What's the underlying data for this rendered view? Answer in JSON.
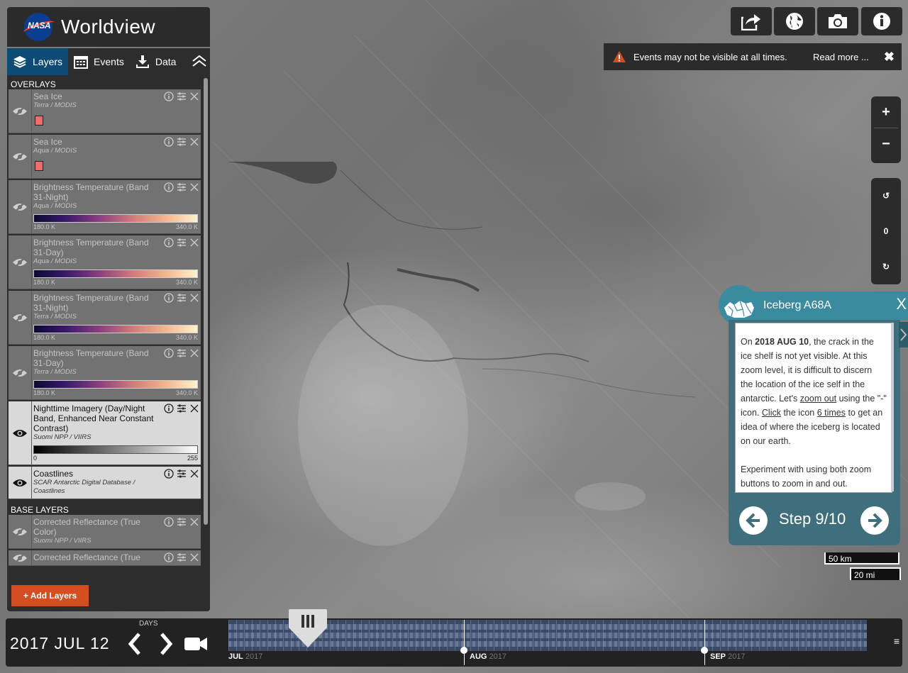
{
  "app": {
    "title": "Worldview",
    "agency": "NASA"
  },
  "tabs": [
    {
      "label": "Layers",
      "icon": "layers-icon"
    },
    {
      "label": "Events",
      "icon": "calendar-icon"
    },
    {
      "label": "Data",
      "icon": "download-icon"
    }
  ],
  "overlays_header": "OVERLAYS",
  "base_header": "BASE LAYERS",
  "overlays": [
    {
      "name": "Sea Ice",
      "source": "Terra / MODIS",
      "visible": false,
      "legend": "swatch"
    },
    {
      "name": "Sea Ice",
      "source": "Aqua / MODIS",
      "visible": false,
      "legend": "swatch"
    },
    {
      "name": "Brightness Temperature (Band 31-Night)",
      "source": "Aqua / MODIS",
      "visible": false,
      "legend": "thermal",
      "min": "180.0 K",
      "max": "340.0 K"
    },
    {
      "name": "Brightness Temperature (Band 31-Day)",
      "source": "Aqua / MODIS",
      "visible": false,
      "legend": "thermal",
      "min": "180.0 K",
      "max": "340.0 K"
    },
    {
      "name": "Brightness Temperature (Band 31-Night)",
      "source": "Terra / MODIS",
      "visible": false,
      "legend": "thermal",
      "min": "180.0 K",
      "max": "340.0 K"
    },
    {
      "name": "Brightness Temperature (Band 31-Day)",
      "source": "Terra / MODIS",
      "visible": false,
      "legend": "thermal",
      "min": "180.0 K",
      "max": "340.0 K"
    },
    {
      "name": "Nighttime Imagery (Day/Night Band, Enhanced Near Constant Contrast)",
      "source": "Suomi NPP / VIIRS",
      "visible": true,
      "legend": "gray",
      "min": "0",
      "max": "255"
    },
    {
      "name": "Coastlines",
      "source": "SCAR Antarctic Digital Database / Coastlines",
      "visible": true,
      "legend": "none"
    }
  ],
  "base_layers": [
    {
      "name": "Corrected Reflectance (True Color)",
      "source": "Suomi NPP / VIIRS",
      "visible": false
    },
    {
      "name": "Corrected Reflectance (True",
      "source": "",
      "visible": false
    }
  ],
  "add_layers_label": "+ Add Layers",
  "notice": {
    "text": "Events may not be visible at all times.",
    "link": "Read more ...",
    "close": "✖"
  },
  "zoom": {
    "in": "+",
    "out": "−"
  },
  "rotate": {
    "left": "↺",
    "value": "0",
    "right": "↻"
  },
  "tour": {
    "title": "Iceberg A68A",
    "close": "X",
    "p1_pre": "On ",
    "p1_date": "2018 AUG 10",
    "p1_mid": ", the crack in the ice shelf is not yet visible. At this zoom level, it is difficult to discern the location of the ice self in the antarctic. Let's ",
    "p1_link1": "zoom out",
    "p1_mid2": " using the \"-\" icon. ",
    "p1_link2": "Click",
    "p1_mid3": " the icon ",
    "p1_link3": "6 times",
    "p1_end": " to get an idea of where the iceberg is located on our earth.",
    "p2": "Experiment with using both zoom buttons to zoom in and out.",
    "step": "Step 9/10"
  },
  "scale": {
    "km": "50 km",
    "mi": "20 mi"
  },
  "timeline": {
    "date": "2017 JUL 12",
    "interval": "DAYS",
    "months": [
      {
        "label": "JUL",
        "year": "2017"
      },
      {
        "label": "AUG",
        "year": "2017"
      },
      {
        "label": "SEP",
        "year": "2017"
      }
    ],
    "menu": "≡"
  },
  "colors": {
    "accent": "#0b4b74",
    "tour": "#3a8aa0",
    "add": "#d54e21",
    "warn": "#d54e21"
  }
}
